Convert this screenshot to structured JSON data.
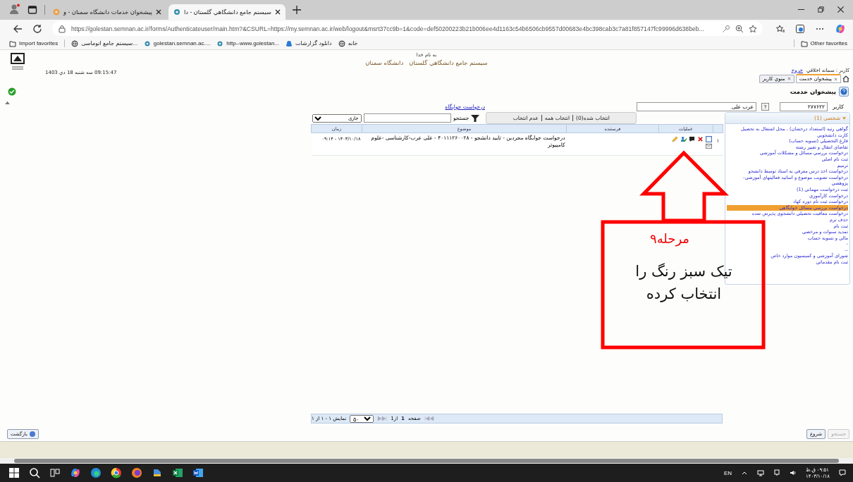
{
  "browser": {
    "tabs": [
      {
        "title": "سیستم جامع دانشگاهي گلستان - دا",
        "selected": true
      },
      {
        "title": "پیشخوان خدمات دانشگاه سمنان - و",
        "selected": false
      }
    ],
    "url": "https://golestan.semnan.ac.ir/forms/Authenticateuser/main.htm?&CSURL=https://my.semnan.ac.ir/web/logout&msrt37cc9b=1&code=def50200223b21b006ee4d1163c54b6506cb9557d00683e4bc398cab3c7a81f857147fc99996d638beb...",
    "favorites": [
      {
        "label": "خانه",
        "kind": "globe"
      },
      {
        "label": "دانلود گزارشات",
        "kind": "cloud"
      },
      {
        "label": "http--www.golestan...",
        "kind": "site"
      },
      {
        "label": "golestan.semnan.ac....",
        "kind": "site"
      },
      {
        "label": "سیستم جامع اتوماسی...",
        "kind": "globe"
      },
      {
        "label": "Import favorites",
        "kind": "folder"
      }
    ],
    "other_favorites": "Other favorites"
  },
  "header": {
    "bismillah": "به نام خدا",
    "system_title": "سیستم جامع دانشگاهي گلستان   دانشگاه سمنان",
    "datetime": "09:15:47 سه شنبه 18 دي 1403",
    "user_label": "کاربر : سمانه اخلاقي",
    "logout": "خروج"
  },
  "page_tabs": [
    {
      "label": "پیشخوان خدمت",
      "selected": true
    },
    {
      "label": "منوي کاربر",
      "selected": false
    }
  ],
  "page_title": "پیشخوان خدمت",
  "user_row": {
    "label": "کاربر",
    "code": "۲۷۷۶۲۲",
    "help": "?",
    "name": "عرب علی"
  },
  "request_link": "درخواست خوابگاه",
  "toolbar": {
    "selection": [
      "انتخاب شده(0)",
      "انتخاب همه",
      "عدم انتخاب"
    ],
    "search_label": "جستجو",
    "filter": "جاری"
  },
  "table": {
    "columns": [
      "عملیات",
      "فرستنده",
      "موضوع",
      "زمان"
    ],
    "rows": [
      {
        "index": "١",
        "subject": "درخواست خوابگاه مجردین - تایید دانشجو - ۴۰۱۱۱۲۶۰۰۲۸ - علی عرب-کارشناسی -علوم کامپیوتر",
        "time": "۱۴۰۳/۱۰/۱۸ - ۰۹:۱۴"
      }
    ]
  },
  "pager": {
    "page_label": "صفحه",
    "page": "1",
    "of": "از1",
    "page_size": "۵۰",
    "summary": "نمایش ۱ - ۱ از ۱"
  },
  "side_panel": {
    "title": "شخصی (1)",
    "items": [
      {
        "label": "گواهي رتبه (استعداد درخشان) ، محل اشتغال به تحصیل",
        "selected": false
      },
      {
        "label": "کارت دانشجويي",
        "selected": false
      },
      {
        "label": "فارغ التحصیلي (تسویه حساب)",
        "selected": false
      },
      {
        "label": "تقاضاي انتقال و تغییر رشته",
        "selected": false
      },
      {
        "label": "درخواست بررسي مسائل و مشکلات آموزشي",
        "selected": false
      },
      {
        "label": "ثبت نام اصلي",
        "selected": false
      },
      {
        "label": "ترمیم",
        "selected": false
      },
      {
        "label": "درخواست اخذ درس معرفي به استاد توسط دانشجو",
        "selected": false
      },
      {
        "label": "درخواست تصویب موضوع و اساتید فعالیتهاي آموزشي-پژوهشي",
        "selected": false
      },
      {
        "label": "ثبت درخواست مهماني (1)",
        "selected": false
      },
      {
        "label": "درخواست کارآموزي",
        "selected": false
      },
      {
        "label": "درخواست ثبت نام دوره کهاد",
        "selected": false
      },
      {
        "label": "درخواست بررسي مسائل خوابگاهي",
        "selected": true
      },
      {
        "label": "درخواست معافیت تحصیلي دانشجوي پذیرش شده",
        "selected": false
      },
      {
        "label": "حذف ترم",
        "selected": false
      },
      {
        "label": "ثبت نام",
        "selected": false
      },
      {
        "label": "تمدید سنوات و مرخصي",
        "selected": false
      },
      {
        "label": "مالي و تسویه حساب",
        "selected": false
      },
      {
        "label": "-",
        "selected": false
      },
      {
        "label": "--",
        "selected": false
      },
      {
        "label": "شوراي آموزشي و کمیسیون موارد خاص",
        "selected": false
      },
      {
        "label": "ثبت نام مقدماتي",
        "selected": false
      }
    ]
  },
  "footer": {
    "back": "بازگشت",
    "buttons": [
      {
        "label": "جستجو",
        "disabled": true
      },
      {
        "label": "شروع",
        "disabled": false
      }
    ]
  },
  "taskbar": {
    "lang": "EN",
    "time": "۰۹:۵۱ ق.ظ",
    "date": "۱۴۰۳/۱۰/۱۸"
  },
  "annotation": {
    "step": "مرحله۹",
    "lines": [
      "تیک سبز رنگ را",
      "انتخاب کرده"
    ]
  }
}
